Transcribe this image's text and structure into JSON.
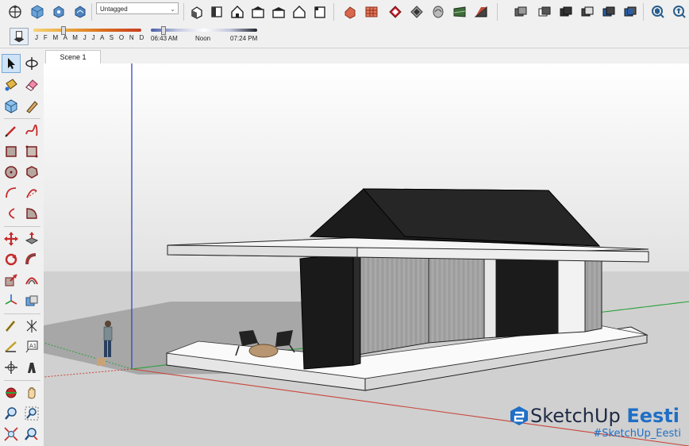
{
  "toolbar": {
    "tag_dropdown_value": "Untagged",
    "buttons_left": [
      "orbit-icon",
      "component-icon",
      "paint-bucket-icon",
      "house-style-icon"
    ],
    "buttons_views": [
      "iso-view-icon",
      "top-view-icon",
      "front-view-icon",
      "right-view-icon",
      "back-view-icon",
      "left-view-icon",
      "bottom-view-icon"
    ],
    "buttons_styles": [
      "xray-icon",
      "back-edges-icon",
      "wireframe-icon",
      "hidden-line-icon",
      "shaded-icon",
      "shaded-textures-icon",
      "monochrome-icon"
    ],
    "buttons_solid": [
      "outer-shell-icon",
      "intersect-icon",
      "union-icon",
      "subtract-icon",
      "trim-icon",
      "split-icon"
    ],
    "buttons_extension": [
      "warehouse-icon",
      "extension-warehouse-icon"
    ]
  },
  "shadows": {
    "months_label": "J F M A M J J A S O N D",
    "time_start": "06:43 AM",
    "time_mid": "Noon",
    "time_end": "07:24 PM"
  },
  "left_toolbar": {
    "tools": [
      "select-icon",
      "orbit-icon",
      "paint-bucket-icon",
      "eraser-icon",
      "component-icon",
      "tape-measure-icon",
      "pencil-icon",
      "freehand-icon",
      "rectangle-icon",
      "rotated-rectangle-icon",
      "circle-icon",
      "polygon-icon",
      "arc-icon",
      "two-point-arc-icon",
      "three-point-arc-icon",
      "pie-icon",
      "move-icon",
      "push-pull-icon",
      "rotate-icon",
      "follow-me-icon",
      "scale-icon",
      "offset-icon",
      "axes-icon",
      "section-icon",
      "tape-icon",
      "text-icon",
      "protractor-icon",
      "3d-text-icon",
      "position-camera-icon",
      "walk-icon",
      "orbit-tool-icon",
      "pan-icon",
      "zoom-icon",
      "zoom-window-icon",
      "zoom-extents-icon",
      "search-icon"
    ]
  },
  "scene": {
    "tab_label": "Scene 1"
  },
  "branding": {
    "name_part1": "SketchUp",
    "name_part2": "Eesti",
    "hashtag": "#SketchUp_Eesti",
    "color": "#1f6fc6"
  }
}
